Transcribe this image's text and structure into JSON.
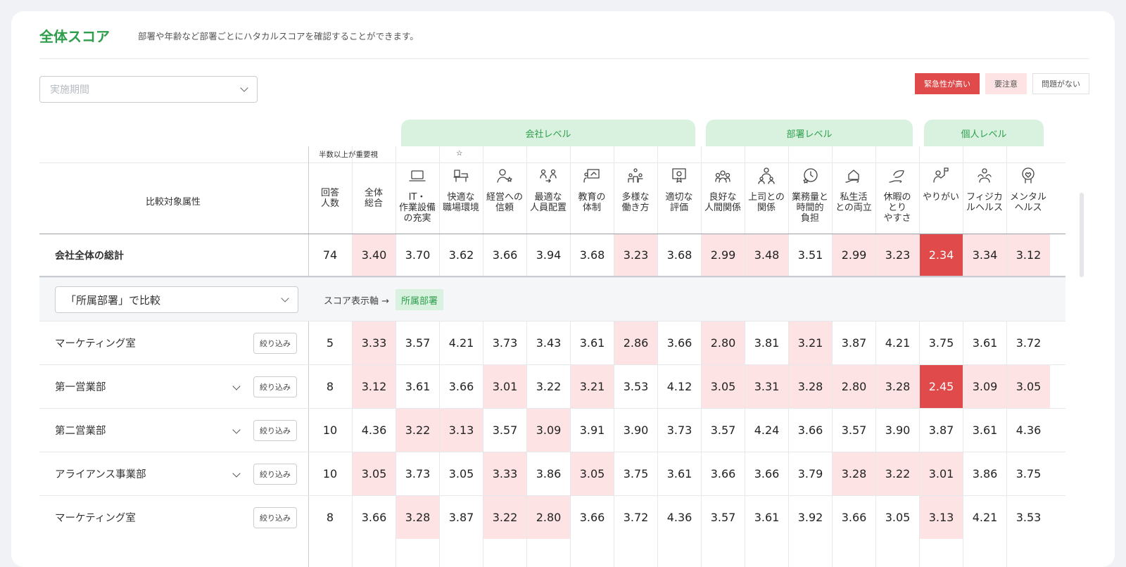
{
  "header": {
    "title": "全体スコア",
    "subtitle": "部署や年齢など部署ごとにハタカルスコアを確認することができます。"
  },
  "period": {
    "placeholder": "実施期間"
  },
  "legend": {
    "urgent": "緊急性が高い",
    "caution": "要注意",
    "ok": "問題がない"
  },
  "colors": {
    "accent": "#2e9e4d",
    "urgent": "#e04a4a",
    "caution": "#fde3e3",
    "category_bg": "#d9f2df"
  },
  "categories": {
    "company": "会社レベル",
    "dept": "部署レベル",
    "individual": "個人レベル"
  },
  "notes": {
    "half": "半数以上が重要視",
    "star": "☆"
  },
  "table": {
    "attr_header": "比較対象属性",
    "col_count_header": "回答\n人数",
    "col_total_header": "全体\n総合",
    "metrics": [
      {
        "label": "IT・\n作業設備\nの充実",
        "icon": "laptop-icon"
      },
      {
        "label": "快適な\n職場環境",
        "icon": "office-desk-icon"
      },
      {
        "label": "経営への\n信頼",
        "icon": "manager-star-icon"
      },
      {
        "label": "最適な\n人員配置",
        "icon": "people-swap-icon"
      },
      {
        "label": "教育の\n体制",
        "icon": "teaching-board-icon"
      },
      {
        "label": "多様な\n働き方",
        "icon": "diverse-people-icon"
      },
      {
        "label": "適切な\n評価",
        "icon": "certificate-icon"
      },
      {
        "label": "良好な\n人間関係",
        "icon": "group-icon"
      },
      {
        "label": "上司との\n関係",
        "icon": "boss-icon"
      },
      {
        "label": "業務量と\n時間的\n負担",
        "icon": "clock-star-icon"
      },
      {
        "label": "私生活\nとの両立",
        "icon": "home-hand-icon"
      },
      {
        "label": "休暇の\nとり\nやすさ",
        "icon": "leaf-hand-icon"
      },
      {
        "label": "やりがい",
        "icon": "flag-person-icon"
      },
      {
        "label": "フィジカ\nルヘルス",
        "icon": "muscle-icon"
      },
      {
        "label": "メンタル\nヘルス",
        "icon": "heart-head-icon"
      }
    ],
    "total_row": {
      "label": "会社全体の総計",
      "count": "74",
      "cells": [
        {
          "v": "3.40",
          "s": "p"
        },
        {
          "v": "3.70",
          "s": ""
        },
        {
          "v": "3.62",
          "s": ""
        },
        {
          "v": "3.66",
          "s": ""
        },
        {
          "v": "3.94",
          "s": ""
        },
        {
          "v": "3.68",
          "s": ""
        },
        {
          "v": "3.23",
          "s": "p"
        },
        {
          "v": "3.68",
          "s": ""
        },
        {
          "v": "2.99",
          "s": "p"
        },
        {
          "v": "3.48",
          "s": "p"
        },
        {
          "v": "3.51",
          "s": ""
        },
        {
          "v": "2.99",
          "s": "p"
        },
        {
          "v": "3.23",
          "s": "p"
        },
        {
          "v": "2.34",
          "s": "r"
        },
        {
          "v": "3.34",
          "s": "p"
        },
        {
          "v": "3.12",
          "s": "p"
        }
      ]
    },
    "compare": {
      "select_value": "「所属部署」で比較",
      "axis_label": "スコア表示軸 →",
      "axis_value": "所属部署"
    },
    "filter_label": "絞り込み",
    "rows": [
      {
        "label": "マーケティング室",
        "count": "5",
        "chevron": false,
        "cells": [
          {
            "v": "3.33",
            "s": "p"
          },
          {
            "v": "3.57",
            "s": ""
          },
          {
            "v": "4.21",
            "s": ""
          },
          {
            "v": "3.73",
            "s": ""
          },
          {
            "v": "3.43",
            "s": ""
          },
          {
            "v": "3.61",
            "s": ""
          },
          {
            "v": "2.86",
            "s": "p"
          },
          {
            "v": "3.66",
            "s": ""
          },
          {
            "v": "2.80",
            "s": "p"
          },
          {
            "v": "3.81",
            "s": ""
          },
          {
            "v": "3.21",
            "s": "p"
          },
          {
            "v": "3.87",
            "s": ""
          },
          {
            "v": "4.21",
            "s": ""
          },
          {
            "v": "3.75",
            "s": ""
          },
          {
            "v": "3.61",
            "s": ""
          },
          {
            "v": "3.72",
            "s": ""
          }
        ]
      },
      {
        "label": "第一営業部",
        "count": "8",
        "chevron": true,
        "cells": [
          {
            "v": "3.12",
            "s": "p"
          },
          {
            "v": "3.61",
            "s": ""
          },
          {
            "v": "3.66",
            "s": ""
          },
          {
            "v": "3.01",
            "s": "p"
          },
          {
            "v": "3.22",
            "s": ""
          },
          {
            "v": "3.21",
            "s": "p"
          },
          {
            "v": "3.53",
            "s": ""
          },
          {
            "v": "4.12",
            "s": ""
          },
          {
            "v": "3.05",
            "s": "p"
          },
          {
            "v": "3.31",
            "s": "p"
          },
          {
            "v": "3.28",
            "s": "p"
          },
          {
            "v": "2.80",
            "s": "p"
          },
          {
            "v": "3.28",
            "s": "p"
          },
          {
            "v": "2.45",
            "s": "r"
          },
          {
            "v": "3.09",
            "s": "p"
          },
          {
            "v": "3.05",
            "s": "p"
          }
        ]
      },
      {
        "label": "第二営業部",
        "count": "10",
        "chevron": true,
        "cells": [
          {
            "v": "4.36",
            "s": ""
          },
          {
            "v": "3.22",
            "s": "p"
          },
          {
            "v": "3.13",
            "s": "p"
          },
          {
            "v": "3.57",
            "s": ""
          },
          {
            "v": "3.09",
            "s": "p"
          },
          {
            "v": "3.91",
            "s": ""
          },
          {
            "v": "3.90",
            "s": ""
          },
          {
            "v": "3.73",
            "s": ""
          },
          {
            "v": "3.57",
            "s": ""
          },
          {
            "v": "4.24",
            "s": ""
          },
          {
            "v": "3.66",
            "s": ""
          },
          {
            "v": "3.57",
            "s": ""
          },
          {
            "v": "3.90",
            "s": ""
          },
          {
            "v": "3.87",
            "s": ""
          },
          {
            "v": "3.61",
            "s": ""
          },
          {
            "v": "4.36",
            "s": ""
          }
        ]
      },
      {
        "label": "アライアンス事業部",
        "count": "10",
        "chevron": true,
        "cells": [
          {
            "v": "3.05",
            "s": "p"
          },
          {
            "v": "3.73",
            "s": ""
          },
          {
            "v": "3.05",
            "s": ""
          },
          {
            "v": "3.33",
            "s": "p"
          },
          {
            "v": "3.86",
            "s": ""
          },
          {
            "v": "3.05",
            "s": "p"
          },
          {
            "v": "3.75",
            "s": ""
          },
          {
            "v": "3.61",
            "s": ""
          },
          {
            "v": "3.66",
            "s": ""
          },
          {
            "v": "3.66",
            "s": ""
          },
          {
            "v": "3.79",
            "s": ""
          },
          {
            "v": "3.28",
            "s": "p"
          },
          {
            "v": "3.22",
            "s": "p"
          },
          {
            "v": "3.01",
            "s": "p"
          },
          {
            "v": "3.86",
            "s": ""
          },
          {
            "v": "3.75",
            "s": ""
          }
        ]
      },
      {
        "label": "マーケティング室",
        "count": "8",
        "chevron": false,
        "cells": [
          {
            "v": "3.66",
            "s": ""
          },
          {
            "v": "3.28",
            "s": "p"
          },
          {
            "v": "3.87",
            "s": ""
          },
          {
            "v": "3.22",
            "s": "p"
          },
          {
            "v": "2.80",
            "s": "p"
          },
          {
            "v": "3.66",
            "s": ""
          },
          {
            "v": "3.72",
            "s": ""
          },
          {
            "v": "4.36",
            "s": ""
          },
          {
            "v": "3.57",
            "s": ""
          },
          {
            "v": "3.61",
            "s": ""
          },
          {
            "v": "3.92",
            "s": ""
          },
          {
            "v": "3.66",
            "s": ""
          },
          {
            "v": "3.05",
            "s": ""
          },
          {
            "v": "3.13",
            "s": "p"
          },
          {
            "v": "4.21",
            "s": ""
          },
          {
            "v": "3.53",
            "s": ""
          }
        ]
      }
    ]
  }
}
